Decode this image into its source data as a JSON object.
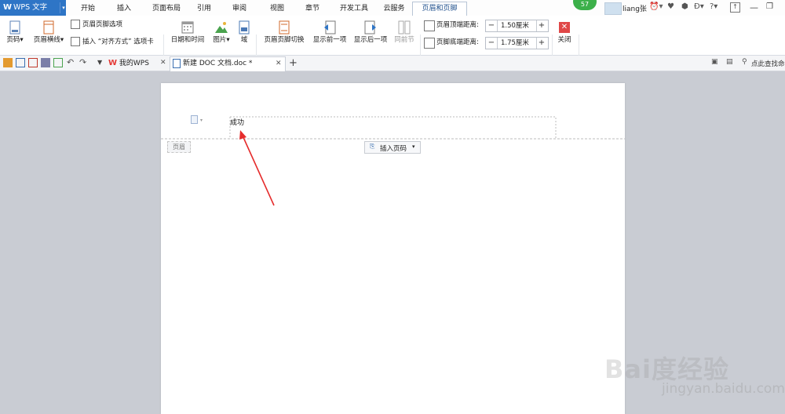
{
  "app": {
    "brand": "WPS 文字",
    "badge_count": "57"
  },
  "menu_tabs": [
    "开始",
    "插入",
    "页面布局",
    "引用",
    "审阅",
    "视图",
    "章节",
    "开发工具",
    "云服务",
    "页眉和页脚"
  ],
  "user": {
    "name": "liang张"
  },
  "ribbon": {
    "page_number": "页码",
    "header_line": "页眉横线",
    "header_footer_options": "页眉页脚选项",
    "insert_align_tab": "插入 “对齐方式” 选项卡",
    "date_time": "日期和时间",
    "picture": "图片",
    "field": "域",
    "header_footer_switch": "页眉页脚切换",
    "show_prev": "显示前一项",
    "show_next": "显示后一项",
    "same_as_prev": "同前节",
    "header_top_distance_label": "页眉顶端距离:",
    "header_top_distance_value": "1.50厘米",
    "footer_bottom_distance_label": "页脚底端距离:",
    "footer_bottom_distance_value": "1.75厘米",
    "close": "关闭"
  },
  "doc_tabs": {
    "my_wps": "我的WPS",
    "current_doc": "新建 DOC 文档.doc *"
  },
  "search": {
    "placeholder": "点此查找命"
  },
  "document": {
    "header_text": "成功",
    "header_label": "页眉",
    "insert_page_number": "插入页码"
  },
  "watermark": {
    "brand": "Bai度经验",
    "url": "jingyan.baidu.com"
  },
  "colors": {
    "brand_blue": "#2e75c6",
    "active_tab_text": "#1e4f8c",
    "arrow_red": "#e52b2b",
    "close_red": "#e04848",
    "badge_green": "#3cb04a"
  }
}
